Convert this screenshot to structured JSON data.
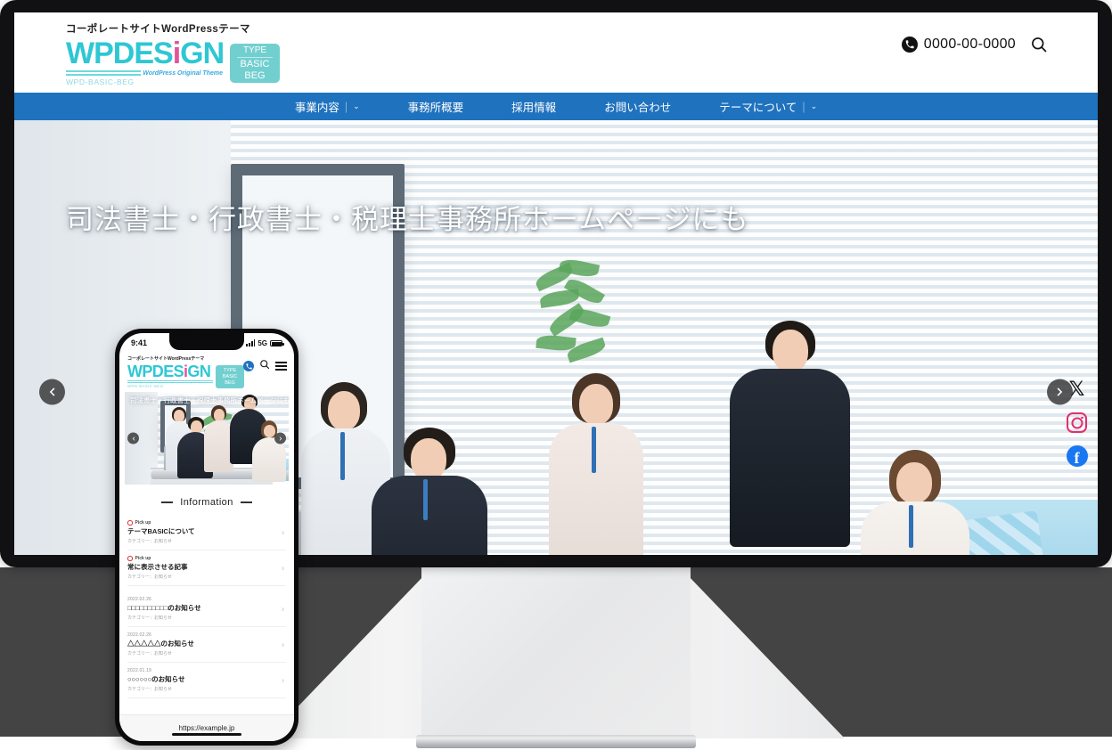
{
  "header": {
    "tagline": "コーポレートサイトWordPressテーマ",
    "logo_word_a": "WPDES",
    "logo_word_i": "i",
    "logo_word_b": "GN",
    "logo_sub": "WPD-BASIC-BEG",
    "logo_theme_note": "WordPress Original Theme",
    "badge_type": "TYPE",
    "badge_basic": "BASIC",
    "badge_beg": "BEG",
    "phone_number": "0000-00-0000",
    "phone_icon": "phone-icon",
    "search_icon": "search-icon"
  },
  "nav": {
    "items": [
      {
        "label": "事業内容",
        "has_dropdown": true
      },
      {
        "label": "事務所概要",
        "has_dropdown": false
      },
      {
        "label": "採用情報",
        "has_dropdown": false
      },
      {
        "label": "お問い合わせ",
        "has_dropdown": false
      },
      {
        "label": "テーマについて",
        "has_dropdown": true
      }
    ],
    "divider": "|",
    "caret": "⌄",
    "background_color": "#1f72be"
  },
  "hero": {
    "title": "司法書士・行政書士・税理士事務所ホームページにも",
    "prev_label": "‹",
    "next_label": "›"
  },
  "socials": [
    {
      "name": "x-icon",
      "glyph": "𝕏",
      "color": "#111111"
    },
    {
      "name": "instagram-icon",
      "glyph": "",
      "color": "#e1306c"
    },
    {
      "name": "facebook-icon",
      "glyph": "f",
      "color": "#1877f2"
    }
  ],
  "phone": {
    "status_time": "9:41",
    "status_network": "5G",
    "tagline": "コーポレートサイトWordPressテーマ",
    "logo_word_a": "WPDES",
    "logo_word_i": "i",
    "logo_word_b": "GN",
    "logo_sub": "WPD-BASIC-BEG",
    "badge_type": "TYPE",
    "badge_basic": "BASIC",
    "badge_beg": "BEG",
    "hero_title": "司法書士・行政書士・税理士事務所ホームページにも",
    "info_heading": "Information",
    "url": "https://example.jp",
    "news": [
      {
        "pickup": "Pick up",
        "date": "",
        "title": "テーマBASICについて",
        "category": "カテゴリー：お知らせ"
      },
      {
        "pickup": "Pick up",
        "date": "",
        "title": "常に表示させる記事",
        "category": "カテゴリー：お知らせ"
      },
      {
        "pickup": "",
        "date": "2022.02.26",
        "title": "□□□□□□□□□□のお知らせ",
        "category": "カテゴリー：お知らせ"
      },
      {
        "pickup": "",
        "date": "2022.02.26",
        "title": "△△△△△のお知らせ",
        "category": "カテゴリー：お知らせ"
      },
      {
        "pickup": "",
        "date": "2022.01.19",
        "title": "○○○○○○のお知らせ",
        "category": "カテゴリー：お知らせ"
      }
    ]
  }
}
